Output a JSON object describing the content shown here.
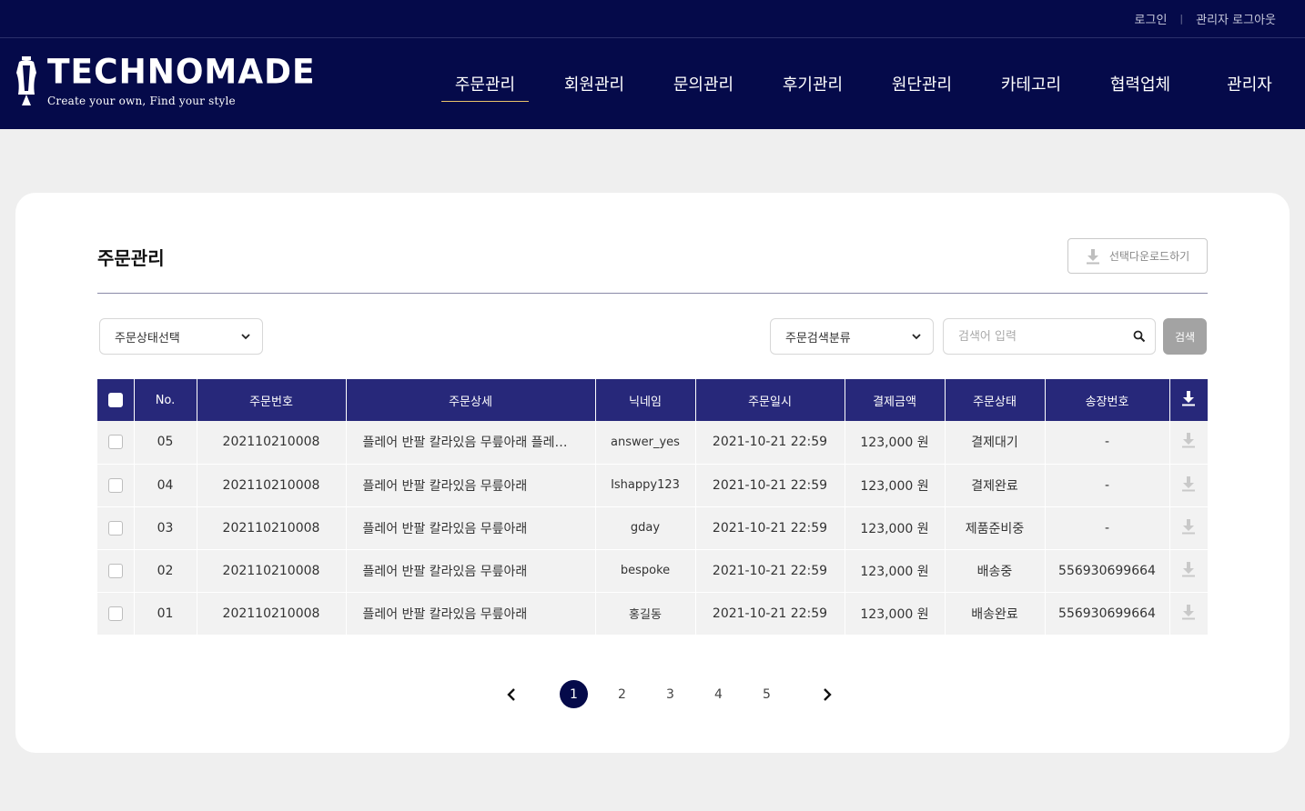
{
  "header": {
    "top_links": [
      "로그인",
      "관리자 로그아웃"
    ],
    "logo_title": "TECHNOMADE",
    "logo_subtitle": "Create your own, Find your style",
    "nav": [
      "주문관리",
      "회원관리",
      "문의관리",
      "후기관리",
      "원단관리",
      "카테고리",
      "협력업체",
      "관리자"
    ],
    "active_nav": "주문관리"
  },
  "page": {
    "title": "주문관리",
    "download_button": "선택다운로드하기",
    "status_select": "주문상태선택",
    "category_select": "주문검색분류",
    "search_placeholder": "검색어 입력",
    "search_button": "검색"
  },
  "table": {
    "headers": [
      "No.",
      "주문번호",
      "주문상세",
      "닉네임",
      "주문일시",
      "결제금액",
      "주문상태",
      "송장번호"
    ],
    "rows": [
      {
        "no": "05",
        "order_no": "202110210008",
        "detail": "플레어 반팔 칼라있음 무릎아래 플레어 반팔 칼라있음 무릎아래",
        "nickname": "answer_yes",
        "date": "2021-10-21 22:59",
        "amount": "123,000 원",
        "status": "결제대기",
        "invoice": "-"
      },
      {
        "no": "04",
        "order_no": "202110210008",
        "detail": "플레어 반팔 칼라있음 무릎아래",
        "nickname": "Ishappy123",
        "date": "2021-10-21 22:59",
        "amount": "123,000 원",
        "status": "결제완료",
        "invoice": "-"
      },
      {
        "no": "03",
        "order_no": "202110210008",
        "detail": "플레어 반팔 칼라있음 무릎아래",
        "nickname": "gday",
        "date": "2021-10-21 22:59",
        "amount": "123,000 원",
        "status": "제품준비중",
        "invoice": "-"
      },
      {
        "no": "02",
        "order_no": "202110210008",
        "detail": "플레어 반팔 칼라있음 무릎아래",
        "nickname": "bespoke",
        "date": "2021-10-21 22:59",
        "amount": "123,000 원",
        "status": "배송중",
        "invoice": "556930699664"
      },
      {
        "no": "01",
        "order_no": "202110210008",
        "detail": "플레어 반팔 칼라있음 무릎아래",
        "nickname": "홍길동",
        "date": "2021-10-21 22:59",
        "amount": "123,000 원",
        "status": "배송완료",
        "invoice": "556930699664"
      }
    ]
  },
  "pagination": {
    "pages": [
      "1",
      "2",
      "3",
      "4",
      "5"
    ],
    "current": "1"
  },
  "colors": {
    "navy": "#050a4a",
    "table_header": "#27287a",
    "accent_underline": "#e9c46a"
  },
  "icons": [
    "download-icon",
    "chevron-down-icon",
    "search-icon",
    "chevron-left-icon",
    "chevron-right-icon",
    "dress-form-logo-icon"
  ]
}
